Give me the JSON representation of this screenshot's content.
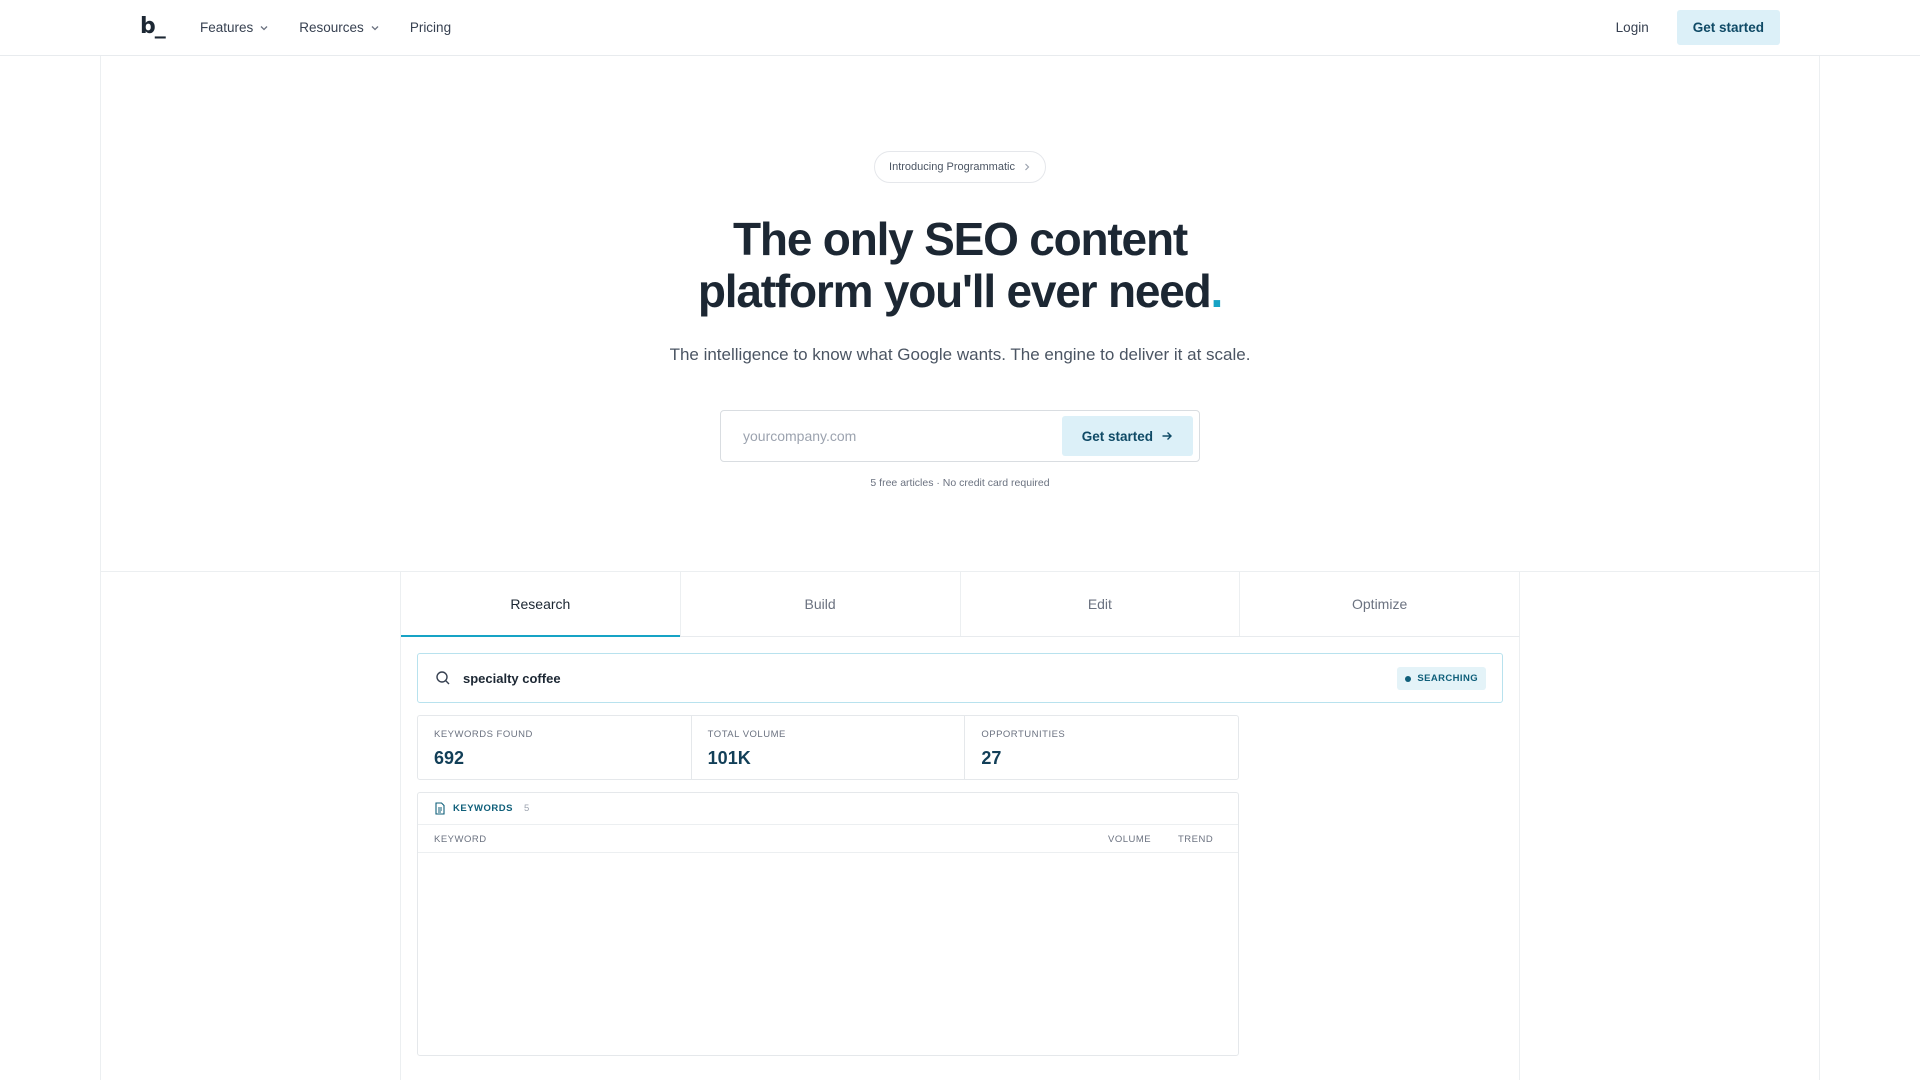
{
  "header": {
    "logo": "b_",
    "nav": [
      {
        "label": "Features",
        "has_dropdown": true
      },
      {
        "label": "Resources",
        "has_dropdown": true
      },
      {
        "label": "Pricing",
        "has_dropdown": false
      }
    ],
    "login_label": "Login",
    "cta_label": "Get started"
  },
  "hero": {
    "pill_label": "Introducing Programmatic",
    "headline_line1": "The only SEO content",
    "headline_line2": "platform you'll ever need",
    "headline_dot": ".",
    "subhead": "The intelligence to know what Google wants. The engine to deliver it at scale.",
    "signup": {
      "placeholder": "yourcompany.com",
      "value": "",
      "button_label": "Get started"
    },
    "note": "5 free articles · No credit card required"
  },
  "tabs": [
    {
      "label": "Research",
      "active": true
    },
    {
      "label": "Build",
      "active": false
    },
    {
      "label": "Edit",
      "active": false
    },
    {
      "label": "Optimize",
      "active": false
    }
  ],
  "demo": {
    "search_query": "specialty coffee",
    "status": "SEARCHING",
    "stats": [
      {
        "label": "KEYWORDS FOUND",
        "value": "692"
      },
      {
        "label": "TOTAL VOLUME",
        "value": "101K"
      },
      {
        "label": "OPPORTUNITIES",
        "value": "27"
      }
    ],
    "keywords_panel": {
      "title": "KEYWORDS",
      "count": "5",
      "columns": [
        "KEYWORD",
        "VOLUME",
        "TREND"
      ],
      "rows": []
    }
  },
  "colors": {
    "accent": "#17a3c5",
    "button_bg": "#dcf0f8",
    "button_text": "#0f4a66",
    "heading": "#1c2733"
  }
}
